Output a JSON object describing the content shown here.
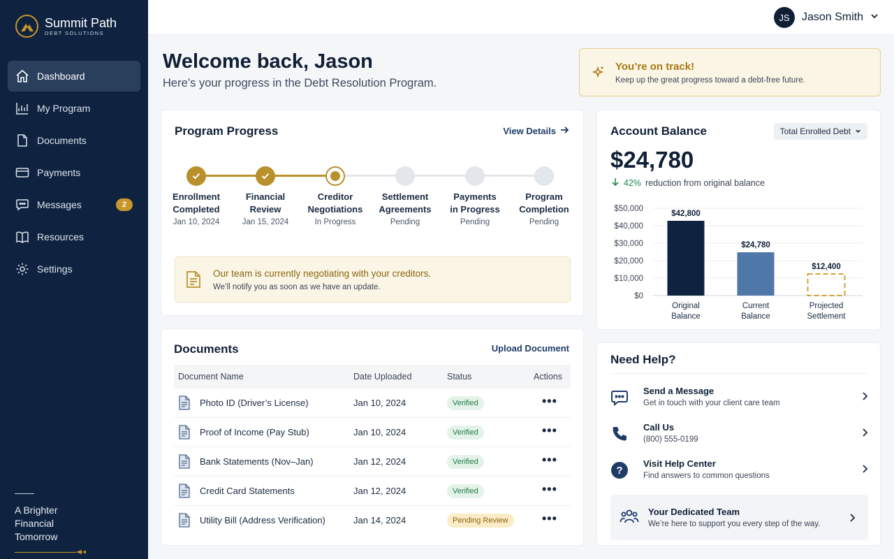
{
  "brand": {
    "name": "Summit Path",
    "sub": "DEBT SOLUTIONS"
  },
  "nav": [
    {
      "label": "Dashboard",
      "icon": "home-icon",
      "active": true
    },
    {
      "label": "My Program",
      "icon": "chart-icon"
    },
    {
      "label": "Documents",
      "icon": "file-icon"
    },
    {
      "label": "Payments",
      "icon": "card-icon"
    },
    {
      "label": "Messages",
      "icon": "chat-icon",
      "badge": "2"
    },
    {
      "label": "Resources",
      "icon": "book-icon"
    },
    {
      "label": "Settings",
      "icon": "gear-icon"
    }
  ],
  "tagline": {
    "line1": "A Brighter",
    "line2": "Financial Tomorrow"
  },
  "user": {
    "initials": "JS",
    "name": "Jason Smith"
  },
  "welcome": {
    "title": "Welcome back, Jason",
    "subtitle": "Here’s your progress in the Debt Resolution Program."
  },
  "track": {
    "title": "You’re on track!",
    "subtitle": "Keep up the great progress toward a debt-free future."
  },
  "progress": {
    "title": "Program Progress",
    "view_details": "View Details",
    "steps": [
      {
        "line1": "Enrollment",
        "line2": "Completed",
        "status": "Jan 10, 2024",
        "state": "done"
      },
      {
        "line1": "Financial",
        "line2": "Review",
        "status": "Jan 15, 2024",
        "state": "done"
      },
      {
        "line1": "Creditor",
        "line2": "Negotiations",
        "status": "In Progress",
        "state": "current"
      },
      {
        "line1": "Settlement",
        "line2": "Agreements",
        "status": "Pending",
        "state": "todo"
      },
      {
        "line1": "Payments",
        "line2": "in Progress",
        "status": "Pending",
        "state": "todo"
      },
      {
        "line1": "Program",
        "line2": "Completion",
        "status": "Pending",
        "state": "todo"
      }
    ],
    "notice_title": "Our team is currently negotiating with your creditors.",
    "notice_sub": "We’ll notify you as soon as we have an update."
  },
  "balance": {
    "title": "Account Balance",
    "select": "Total Enrolled Debt",
    "amount": "$24,780",
    "reduction_pct": "42%",
    "reduction_text": "reduction from original balance"
  },
  "chart_data": {
    "type": "bar",
    "categories": [
      [
        "Original",
        "Balance"
      ],
      [
        "Current",
        "Balance"
      ],
      [
        "Projected",
        "Settlement"
      ]
    ],
    "values": [
      42800,
      24780,
      12400
    ],
    "value_labels": [
      "$42,800",
      "$24,780",
      "$12,400"
    ],
    "yticks": [
      "$0",
      "$10,000",
      "$20,000",
      "$30,000",
      "$40,000",
      "$50,000"
    ],
    "ylim": [
      0,
      50000
    ],
    "colors": [
      "#0f2340",
      "#4f77a8",
      "#d6a234"
    ],
    "styles": [
      "solid",
      "solid",
      "dashed"
    ],
    "grid": true
  },
  "documents": {
    "title": "Documents",
    "upload": "Upload Document",
    "headers": [
      "Document Name",
      "Date Uploaded",
      "Status",
      "Actions"
    ],
    "rows": [
      {
        "name": "Photo ID (Driver’s License)",
        "date": "Jan 10, 2024",
        "status": "Verified",
        "kind": "verified"
      },
      {
        "name": "Proof of Income (Pay Stub)",
        "date": "Jan 10, 2024",
        "status": "Verified",
        "kind": "verified"
      },
      {
        "name": "Bank Statements (Nov–Jan)",
        "date": "Jan 12, 2024",
        "status": "Verified",
        "kind": "verified"
      },
      {
        "name": "Credit Card Statements",
        "date": "Jan 12, 2024",
        "status": "Verified",
        "kind": "verified"
      },
      {
        "name": "Utility Bill (Address Verification)",
        "date": "Jan 14, 2024",
        "status": "Pending Review",
        "kind": "pending"
      }
    ],
    "actions_glyph": "•••"
  },
  "help": {
    "title": "Need Help?",
    "items": [
      {
        "title": "Send a Message",
        "sub": "Get in touch with your client care team",
        "icon": "message-icon"
      },
      {
        "title": "Call Us",
        "sub": "(800) 555-0199",
        "icon": "phone-icon"
      },
      {
        "title": "Visit Help Center",
        "sub": "Find answers to common questions",
        "icon": "help-icon"
      }
    ],
    "team_title": "Your Dedicated Team",
    "team_sub": "We’re here to support you every step of the way."
  }
}
